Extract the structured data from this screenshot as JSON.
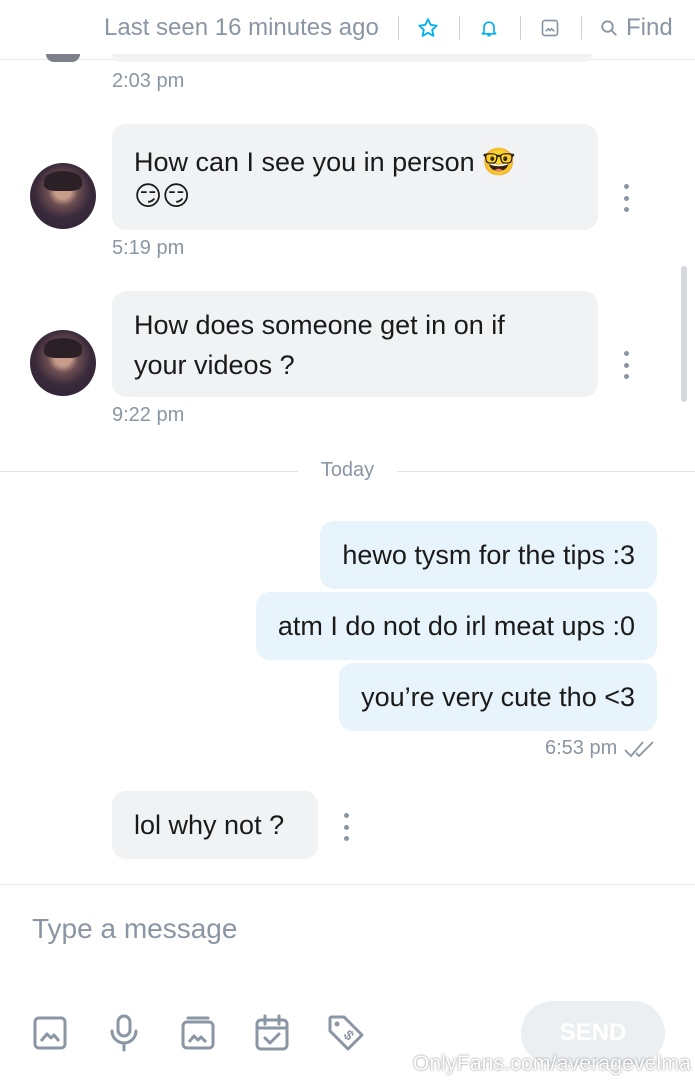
{
  "header": {
    "last_seen": "Last seen 16 minutes ago",
    "icons": [
      "star-icon",
      "bell-icon",
      "media-icon"
    ],
    "find_label": "Find",
    "accent": "#00aff0"
  },
  "messages": {
    "top_time": "2:03 pm",
    "m1": {
      "line1": "How can I see you in person 🤓",
      "line2": "😏😏",
      "time": "5:19 pm"
    },
    "m2": {
      "line1": "How does someone get in on if",
      "line2": "your videos ?",
      "time": "9:22 pm"
    },
    "divider": "Today",
    "out": [
      "hewo tysm for the tips :3",
      "atm I do not do irl meat ups :0",
      "you’re very cute tho <3"
    ],
    "out_time": "6:53 pm",
    "m3": {
      "text": "lol why not ?"
    }
  },
  "composer": {
    "placeholder": "Type a message",
    "send_label": "SEND",
    "icons": [
      "image-icon",
      "microphone-icon",
      "gallery-icon",
      "calendar-icon",
      "price-tag-icon"
    ]
  },
  "watermark": "OnlyFans.com/averagevelma"
}
